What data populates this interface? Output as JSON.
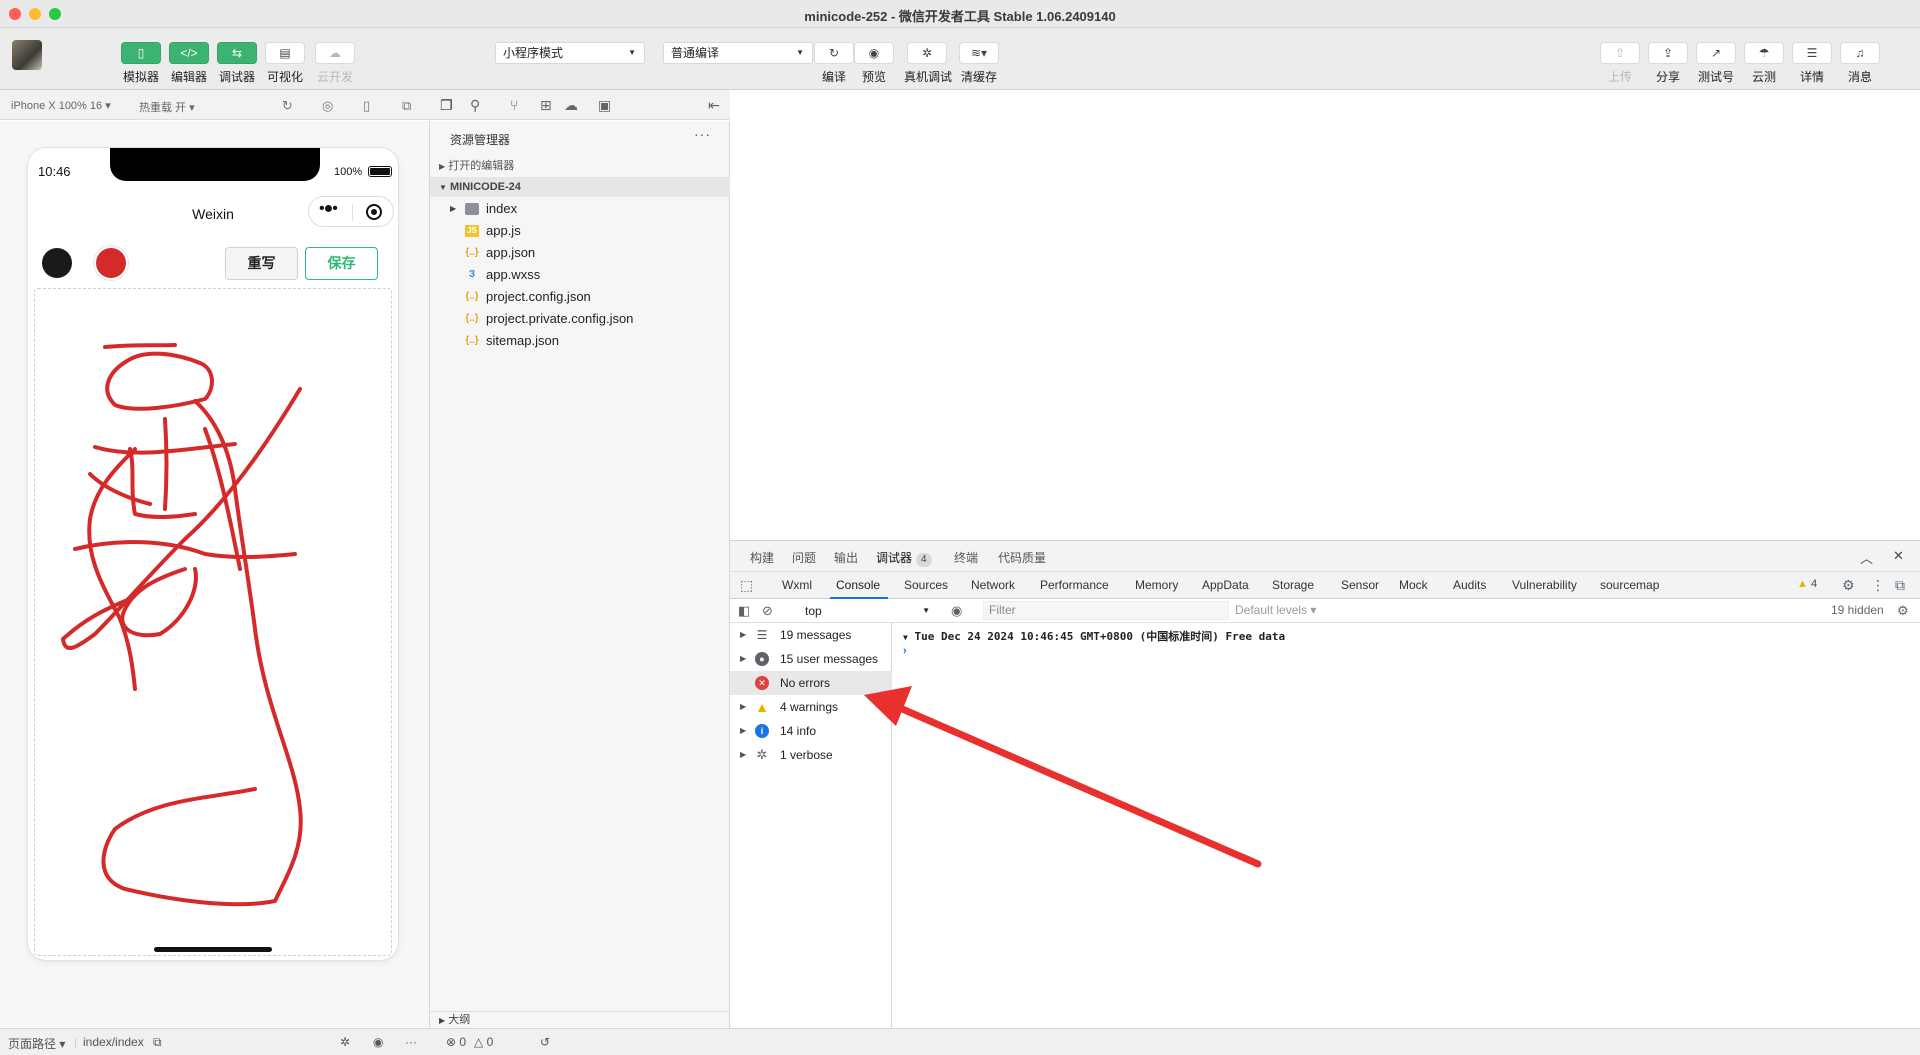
{
  "window": {
    "title": "minicode-252 - 微信开发者工具 Stable 1.06.2409140"
  },
  "toolbar": {
    "left_buttons": [
      "模拟器",
      "编辑器",
      "调试器",
      "可视化",
      "云开发"
    ],
    "mode_select": "小程序模式",
    "compile_select": "普通编译",
    "center_buttons": [
      "编译",
      "预览",
      "真机调试",
      "清缓存"
    ],
    "right_buttons": [
      "上传",
      "分享",
      "测试号",
      "云测",
      "详情",
      "消息"
    ]
  },
  "simulator": {
    "device": "iPhone X 100% 16",
    "hot_reload": "热重载 开",
    "phone": {
      "time": "10:46",
      "battery": "100%",
      "nav_title": "Weixin",
      "colors": [
        "#1a1a1a",
        "#d42a2a"
      ],
      "rewrite_label": "重写",
      "save_label": "保存",
      "stroke_color": "#d42a2a"
    }
  },
  "explorer": {
    "title": "资源管理器",
    "open_editors": "打开的编辑器",
    "project": "MINICODE-24",
    "files": [
      {
        "name": "index",
        "type": "folder"
      },
      {
        "name": "app.js",
        "type": "js"
      },
      {
        "name": "app.json",
        "type": "json"
      },
      {
        "name": "app.wxss",
        "type": "wxss"
      },
      {
        "name": "project.config.json",
        "type": "json"
      },
      {
        "name": "project.private.config.json",
        "type": "json"
      },
      {
        "name": "sitemap.json",
        "type": "json"
      }
    ],
    "outline": "大纲"
  },
  "debug": {
    "panel_tabs": [
      "构建",
      "问题",
      "输出",
      "调试器",
      "终端",
      "代码质量"
    ],
    "debugger_badge": "4",
    "devtools_tabs": [
      "Wxml",
      "Console",
      "Sources",
      "Network",
      "Performance",
      "Memory",
      "AppData",
      "Storage",
      "Sensor",
      "Mock",
      "Audits",
      "Vulnerability",
      "sourcemap"
    ],
    "warning_count": "4",
    "context": "top",
    "filter_placeholder": "Filter",
    "levels": "Default levels",
    "hidden": "19 hidden",
    "sidebar": [
      "19 messages",
      "15 user messages",
      "No errors",
      "4 warnings",
      "14 info",
      "1 verbose"
    ],
    "log_line": "Tue Dec 24 2024 10:46:45 GMT+0800 (中国标准时间) Free data",
    "arrow_color": "#e8312f"
  },
  "statusbar": {
    "page_path_label": "页面路径",
    "page_path": "index/index",
    "errors": "0",
    "warnings": "0"
  }
}
